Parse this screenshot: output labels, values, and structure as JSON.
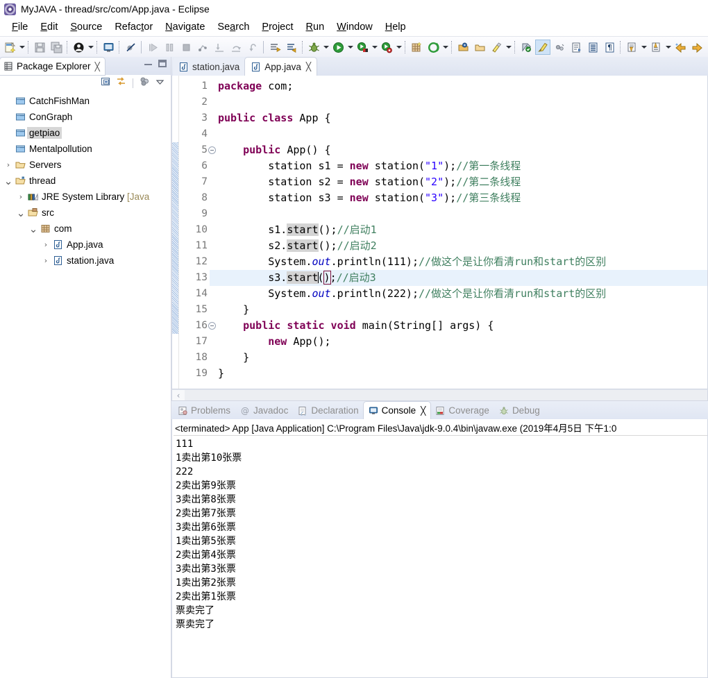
{
  "window": {
    "title": "MyJAVA - thread/src/com/App.java - Eclipse",
    "app_icon": "eclipse-icon"
  },
  "menubar": {
    "items": [
      {
        "label": "File",
        "mnemonic": "F"
      },
      {
        "label": "Edit",
        "mnemonic": "E"
      },
      {
        "label": "Source",
        "mnemonic": "S"
      },
      {
        "label": "Refactor",
        "mnemonic": "t"
      },
      {
        "label": "Navigate",
        "mnemonic": "N"
      },
      {
        "label": "Search",
        "mnemonic": "a"
      },
      {
        "label": "Project",
        "mnemonic": "P"
      },
      {
        "label": "Run",
        "mnemonic": "R"
      },
      {
        "label": "Window",
        "mnemonic": "W"
      },
      {
        "label": "Help",
        "mnemonic": "H"
      }
    ]
  },
  "toolbar": {
    "items": [
      {
        "name": "new-wizard-icon",
        "kind": "icon"
      },
      {
        "name": "new-wizard-dropdown",
        "kind": "arrow"
      },
      {
        "name": "sep",
        "kind": "sep"
      },
      {
        "name": "save-icon",
        "kind": "icon"
      },
      {
        "name": "save-all-icon",
        "kind": "icon"
      },
      {
        "name": "sep",
        "kind": "sep"
      },
      {
        "name": "user-profile-icon",
        "kind": "icon"
      },
      {
        "name": "user-profile-dropdown",
        "kind": "arrow"
      },
      {
        "name": "sep",
        "kind": "sep"
      },
      {
        "name": "open-console-icon",
        "kind": "icon"
      },
      {
        "name": "sep",
        "kind": "sep"
      },
      {
        "name": "skip-breakpoints-icon",
        "kind": "icon"
      },
      {
        "name": "sep-solid",
        "kind": "sepsolid"
      },
      {
        "name": "resume-icon",
        "kind": "icon"
      },
      {
        "name": "suspend-icon",
        "kind": "icon"
      },
      {
        "name": "terminate-icon",
        "kind": "icon"
      },
      {
        "name": "disconnect-icon",
        "kind": "icon"
      },
      {
        "name": "step-into-icon",
        "kind": "icon"
      },
      {
        "name": "step-over-icon",
        "kind": "icon"
      },
      {
        "name": "step-return-icon",
        "kind": "icon"
      },
      {
        "name": "sep-solid",
        "kind": "sepsolid"
      },
      {
        "name": "next-annotation-icon",
        "kind": "icon"
      },
      {
        "name": "previous-annotation-icon",
        "kind": "icon"
      },
      {
        "name": "sep",
        "kind": "sep"
      },
      {
        "name": "debug-icon",
        "kind": "icon"
      },
      {
        "name": "debug-dropdown",
        "kind": "arrow"
      },
      {
        "name": "run-icon",
        "kind": "icon"
      },
      {
        "name": "run-dropdown",
        "kind": "arrow"
      },
      {
        "name": "coverage-icon",
        "kind": "icon"
      },
      {
        "name": "coverage-dropdown",
        "kind": "arrow"
      },
      {
        "name": "external-tools-icon",
        "kind": "icon"
      },
      {
        "name": "external-tools-dropdown",
        "kind": "arrow"
      },
      {
        "name": "sep",
        "kind": "sep"
      },
      {
        "name": "new-java-package-icon",
        "kind": "icon"
      },
      {
        "name": "new-java-class-icon",
        "kind": "icon"
      },
      {
        "name": "new-class-dropdown",
        "kind": "arrow"
      },
      {
        "name": "sep",
        "kind": "sep"
      },
      {
        "name": "open-type-icon",
        "kind": "icon"
      },
      {
        "name": "open-task-icon",
        "kind": "icon"
      },
      {
        "name": "search-icon",
        "kind": "icon"
      },
      {
        "name": "search-dropdown",
        "kind": "arrow"
      },
      {
        "name": "sep",
        "kind": "sep"
      },
      {
        "name": "toggle-mark-occurrences-icon",
        "kind": "icon"
      },
      {
        "name": "toggle-highlight-icon",
        "kind": "icon",
        "active": true
      },
      {
        "name": "link-with-editor-icon",
        "kind": "icon"
      },
      {
        "name": "open-task-list-icon",
        "kind": "icon"
      },
      {
        "name": "show-whitespace-icon",
        "kind": "icon"
      },
      {
        "name": "show-formatting-icon",
        "kind": "icon"
      },
      {
        "name": "sep",
        "kind": "sep"
      },
      {
        "name": "next-edit-location-icon",
        "kind": "icon"
      },
      {
        "name": "next-edit-dropdown",
        "kind": "arrow"
      },
      {
        "name": "previous-edit-location-icon",
        "kind": "icon"
      },
      {
        "name": "previous-edit-dropdown",
        "kind": "arrow"
      },
      {
        "name": "back-icon",
        "kind": "icon"
      },
      {
        "name": "forward-icon",
        "kind": "icon"
      }
    ]
  },
  "explorer": {
    "tab_label": "Package Explorer",
    "tab_icon": "package-explorer-icon",
    "close_glyph": "╳",
    "minimize_tooltip": "Minimize",
    "maximize_tooltip": "Maximize",
    "toolbar": [
      {
        "name": "collapse-all-icon"
      },
      {
        "name": "link-with-editor-icon"
      },
      {
        "name": "view-menu-filters-icon"
      },
      {
        "name": "view-menu-icon"
      }
    ],
    "tree": [
      {
        "label": "CatchFishMan",
        "icon": "project-closed-icon",
        "indent": 1,
        "twist": "",
        "selected": false
      },
      {
        "label": "ConGraph",
        "icon": "project-closed-icon",
        "indent": 1,
        "twist": "",
        "selected": false
      },
      {
        "label": "getpiao",
        "icon": "project-closed-icon",
        "indent": 1,
        "twist": "",
        "selected": true
      },
      {
        "label": "Mentalpollution",
        "icon": "project-closed-icon",
        "indent": 1,
        "twist": "",
        "selected": false
      },
      {
        "label": "Servers",
        "icon": "folder-icon",
        "indent": 1,
        "twist": "collapsed",
        "selected": false
      },
      {
        "label": "thread",
        "icon": "java-project-icon",
        "indent": 1,
        "twist": "expanded",
        "selected": false
      },
      {
        "label": "JRE System Library ",
        "suffix": "[Java",
        "icon": "jre-library-icon",
        "indent": 2,
        "twist": "collapsed",
        "selected": false
      },
      {
        "label": "src",
        "icon": "source-folder-icon",
        "indent": 2,
        "twist": "expanded",
        "selected": false
      },
      {
        "label": "com",
        "icon": "package-icon",
        "indent": 3,
        "twist": "expanded",
        "selected": false
      },
      {
        "label": "App.java",
        "icon": "java-file-icon",
        "indent": 4,
        "twist": "collapsed",
        "selected": false
      },
      {
        "label": "station.java",
        "icon": "java-file-icon",
        "indent": 4,
        "twist": "collapsed",
        "selected": false
      }
    ]
  },
  "editor": {
    "tabs": [
      {
        "label": "station.java",
        "icon": "java-file-icon",
        "active": false,
        "closable": false
      },
      {
        "label": "App.java",
        "icon": "java-file-icon",
        "active": true,
        "closable": true,
        "close_glyph": "╳"
      }
    ],
    "current_line": 13,
    "lines": [
      {
        "n": 1,
        "fold": false,
        "tokens": [
          {
            "t": "package ",
            "c": "kw"
          },
          {
            "t": "com;",
            "c": ""
          }
        ]
      },
      {
        "n": 2,
        "fold": false,
        "tokens": []
      },
      {
        "n": 3,
        "fold": false,
        "tokens": [
          {
            "t": "public ",
            "c": "kw"
          },
          {
            "t": "class ",
            "c": "kw"
          },
          {
            "t": "App {",
            "c": ""
          }
        ]
      },
      {
        "n": 4,
        "fold": false,
        "tokens": []
      },
      {
        "n": 5,
        "fold": true,
        "tokens": [
          {
            "t": "    ",
            "c": ""
          },
          {
            "t": "public ",
            "c": "kw"
          },
          {
            "t": "App() {",
            "c": ""
          }
        ]
      },
      {
        "n": 6,
        "fold": false,
        "tokens": [
          {
            "t": "        station s1 = ",
            "c": ""
          },
          {
            "t": "new ",
            "c": "kw"
          },
          {
            "t": "station(",
            "c": ""
          },
          {
            "t": "\"1\"",
            "c": "str"
          },
          {
            "t": ");",
            "c": ""
          },
          {
            "t": "//第一条线程",
            "c": "cmt"
          }
        ]
      },
      {
        "n": 7,
        "fold": false,
        "tokens": [
          {
            "t": "        station s2 = ",
            "c": ""
          },
          {
            "t": "new ",
            "c": "kw"
          },
          {
            "t": "station(",
            "c": ""
          },
          {
            "t": "\"2\"",
            "c": "str"
          },
          {
            "t": ");",
            "c": ""
          },
          {
            "t": "//第二条线程",
            "c": "cmt"
          }
        ]
      },
      {
        "n": 8,
        "fold": false,
        "tokens": [
          {
            "t": "        station s3 = ",
            "c": ""
          },
          {
            "t": "new ",
            "c": "kw"
          },
          {
            "t": "station(",
            "c": ""
          },
          {
            "t": "\"3\"",
            "c": "str"
          },
          {
            "t": ");",
            "c": ""
          },
          {
            "t": "//第三条线程",
            "c": "cmt"
          }
        ]
      },
      {
        "n": 9,
        "fold": false,
        "tokens": []
      },
      {
        "n": 10,
        "fold": false,
        "tokens": [
          {
            "t": "        s1.",
            "c": ""
          },
          {
            "t": "start",
            "c": "hl"
          },
          {
            "t": "();",
            "c": ""
          },
          {
            "t": "//启动1",
            "c": "cmt"
          }
        ]
      },
      {
        "n": 11,
        "fold": false,
        "tokens": [
          {
            "t": "        s2.",
            "c": ""
          },
          {
            "t": "start",
            "c": "hl"
          },
          {
            "t": "();",
            "c": ""
          },
          {
            "t": "//启动2",
            "c": "cmt"
          }
        ]
      },
      {
        "n": 12,
        "fold": false,
        "tokens": [
          {
            "t": "        System.",
            "c": ""
          },
          {
            "t": "out",
            "c": "fld"
          },
          {
            "t": ".println(111);",
            "c": ""
          },
          {
            "t": "//做这个是让你看清run和start的区别",
            "c": "cmt"
          }
        ]
      },
      {
        "n": 13,
        "fold": false,
        "tokens": [
          {
            "t": "        s3.",
            "c": ""
          },
          {
            "t": "start",
            "c": "hl"
          },
          {
            "t": "CARET",
            "c": "caret"
          },
          {
            "t": "(",
            "c": ""
          },
          {
            "t": ")",
            "c": "brk"
          },
          {
            "t": ";",
            "c": ""
          },
          {
            "t": "//启动3",
            "c": "cmt"
          }
        ]
      },
      {
        "n": 14,
        "fold": false,
        "tokens": [
          {
            "t": "        System.",
            "c": ""
          },
          {
            "t": "out",
            "c": "fld"
          },
          {
            "t": ".println(222);",
            "c": ""
          },
          {
            "t": "//做这个是让你看清run和start的区别",
            "c": "cmt"
          }
        ]
      },
      {
        "n": 15,
        "fold": false,
        "tokens": [
          {
            "t": "    }",
            "c": ""
          }
        ]
      },
      {
        "n": 16,
        "fold": true,
        "tokens": [
          {
            "t": "    ",
            "c": ""
          },
          {
            "t": "public static void ",
            "c": "kw"
          },
          {
            "t": "main(String[] args) {",
            "c": ""
          }
        ]
      },
      {
        "n": 17,
        "fold": false,
        "tokens": [
          {
            "t": "        ",
            "c": ""
          },
          {
            "t": "new ",
            "c": "kw"
          },
          {
            "t": "App();",
            "c": ""
          }
        ]
      },
      {
        "n": 18,
        "fold": false,
        "tokens": [
          {
            "t": "    }",
            "c": ""
          }
        ]
      },
      {
        "n": 19,
        "fold": false,
        "tokens": [
          {
            "t": "}",
            "c": ""
          }
        ]
      }
    ],
    "hscroll_left_glyph": "‹"
  },
  "console": {
    "tabs": [
      {
        "label": "Problems",
        "icon": "problems-icon",
        "active": false
      },
      {
        "label": "Javadoc",
        "icon": "javadoc-icon",
        "active": false
      },
      {
        "label": "Declaration",
        "icon": "declaration-icon",
        "active": false
      },
      {
        "label": "Console",
        "icon": "console-icon",
        "active": true,
        "close_glyph": "╳"
      },
      {
        "label": "Coverage",
        "icon": "coverage-icon",
        "active": false
      },
      {
        "label": "Debug",
        "icon": "debug-icon",
        "active": false
      }
    ],
    "header": "<terminated> App [Java Application] C:\\Program Files\\Java\\jdk-9.0.4\\bin\\javaw.exe (2019年4月5日 下午1:0",
    "output": [
      "111",
      "1卖出第10张票",
      "222",
      "2卖出第9张票",
      "3卖出第8张票",
      "2卖出第7张票",
      "3卖出第6张票",
      "1卖出第5张票",
      "2卖出第4张票",
      "3卖出第3张票",
      "1卖出第2张票",
      "2卖出第1张票",
      "票卖完了",
      "票卖完了"
    ]
  },
  "colors": {
    "keyword": "#7f0055",
    "string": "#2a00ff",
    "comment": "#3f7f5f",
    "field": "#0000c0",
    "selection": "#d4d4d4",
    "current_line": "#e8f2fc",
    "tree_selection": "#d6d6d6"
  }
}
